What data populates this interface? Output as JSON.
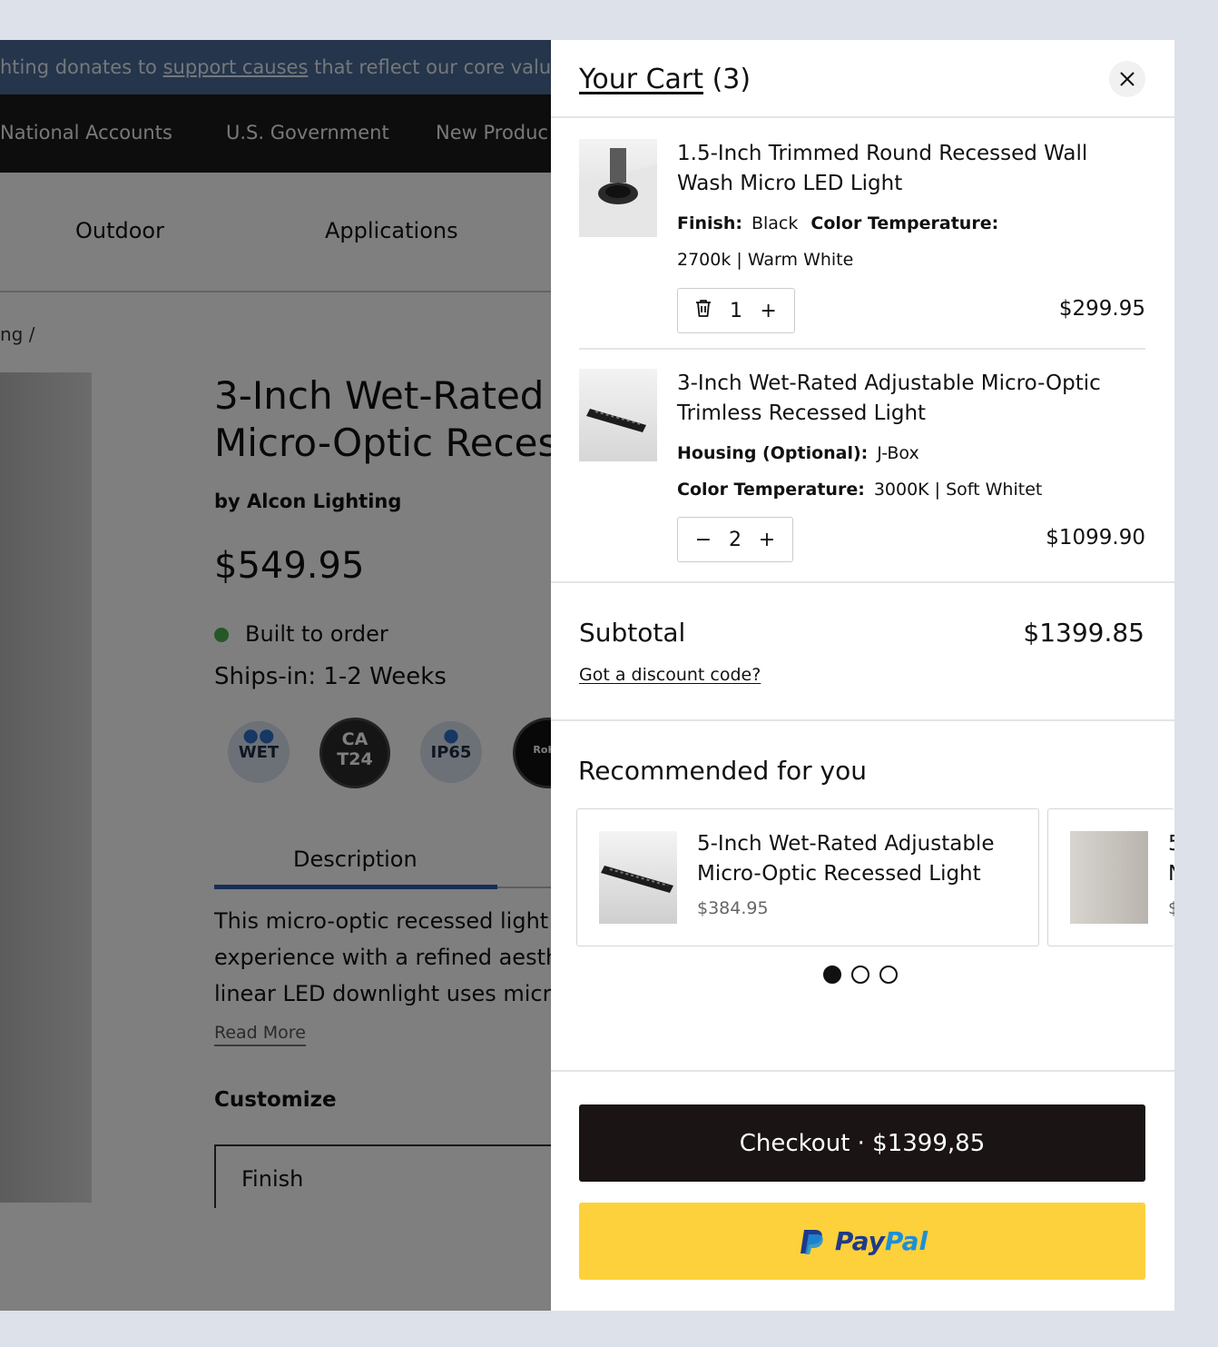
{
  "background_page": {
    "announcement": {
      "prefix": "hting donates to ",
      "link": "support causes",
      "suffix": " that reflect our core valu"
    },
    "top_nav": [
      "National Accounts",
      "U.S. Government",
      "New Produc"
    ],
    "main_nav": [
      "Outdoor",
      "Applications"
    ],
    "breadcrumb": "ng /",
    "product": {
      "title_line1": "3-Inch Wet-Rated",
      "title_line2": "Micro-Optic Reces",
      "by": "by Alcon Lighting",
      "price": "$549.95",
      "stock": "Built to order",
      "ships": "Ships-in: 1-2 Weeks",
      "badges": [
        "WET",
        "CA T24",
        "IP65",
        "RoHS"
      ],
      "tab": "Description",
      "desc_lines": [
        "This micro-optic recessed light",
        "experience with a refined aesth",
        "linear LED downlight uses micro"
      ],
      "read_more": "Read More",
      "customize": "Customize",
      "finish_label": "Finish"
    }
  },
  "cart": {
    "title": "Your Cart",
    "count": "(3)",
    "items": [
      {
        "name": "1.5-Inch Trimmed Round Recessed Wall Wash Micro LED Light",
        "attr1_label": "Finish:",
        "attr1_value": "Black",
        "attr2_label": "Color Temperature:",
        "attr2_value": "2700k | Warm White",
        "qty": "1",
        "price": "$299.95"
      },
      {
        "name": "3-Inch Wet-Rated Adjustable Micro-Optic Trimless Recessed Light",
        "attr1_label": "Housing (Optional):",
        "attr1_value": "J-Box",
        "attr2_label": "Color Temperature:",
        "attr2_value": "3000K | Soft Whitet",
        "qty": "2",
        "price": "$1099.90"
      }
    ],
    "subtotal_label": "Subtotal",
    "subtotal_value": "$1399.85",
    "discount_link": "Got a discount code?",
    "recommended_title": "Recommended for you",
    "recommended": [
      {
        "name_line1": "5-Inch Wet-Rated Adjustable",
        "name_line2": "Micro-Optic Recessed Light",
        "price": "$384.95"
      },
      {
        "name_line1": "5",
        "name_line2": "N",
        "price": "$"
      }
    ],
    "carousel": {
      "pages": 3,
      "active": 1
    },
    "checkout_label": "Checkout · $1399,85",
    "paypal_pay": "Pay",
    "paypal_pal": "Pal"
  },
  "colors": {
    "checkout_bg": "#1a1414",
    "paypal_bg": "#fdd13b",
    "stock_dot": "#4caf50",
    "tab_active": "#2f5da8"
  }
}
